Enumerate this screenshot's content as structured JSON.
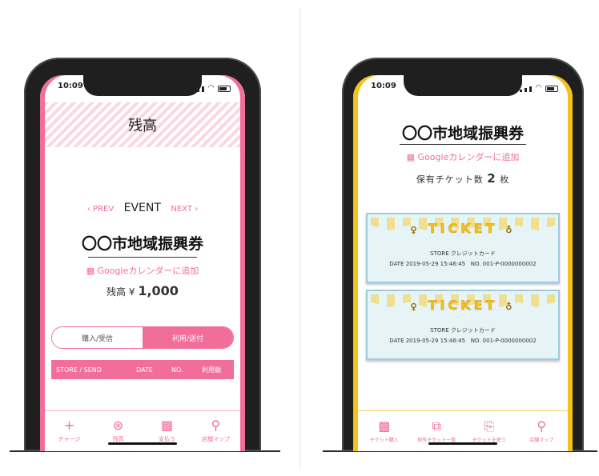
{
  "left_phone": {
    "status_time": "10:09",
    "header_title": "残高",
    "event_nav": {
      "prev": "‹ PREV",
      "label": "EVENT",
      "next": "NEXT ›"
    },
    "voucher_name": "〇〇市地域振興券",
    "calendar_link": "Googleカレンダーに追加",
    "balance_label": "残高 ¥",
    "balance_value": "1,000",
    "tabs": {
      "buy": "購入/受信",
      "use": "利用/送付"
    },
    "table_headers": [
      "STORE / SEND",
      "DATE",
      "NO.",
      "利用額"
    ],
    "nav": [
      {
        "icon": "plus-icon",
        "label": "チャージ"
      },
      {
        "icon": "yen-icon",
        "label": "残高"
      },
      {
        "icon": "qr-icon",
        "label": "支払う"
      },
      {
        "icon": "map-pin-icon",
        "label": "店舗マップ"
      }
    ],
    "accent_color": "#f06e98"
  },
  "right_phone": {
    "status_time": "10:09",
    "voucher_name": "〇〇市地域振興券",
    "calendar_link": "Googleカレンダーに追加",
    "ticket_count_label": "保有チケット数",
    "ticket_count": "2",
    "ticket_count_unit": "枚",
    "tickets": [
      {
        "title": "TICKET",
        "store": "STORE クレジットカード",
        "date": "DATE 2019-05-29 15:46:45",
        "no": "NO. 001-P-0000000002"
      },
      {
        "title": "TICKET",
        "store": "STORE クレジットカード",
        "date": "DATE 2019-05-29 15:46:45",
        "no": "NO. 001-P-0000000002"
      }
    ],
    "nav": [
      {
        "icon": "qr-icon",
        "label": "チケット購入"
      },
      {
        "icon": "ticket-list-icon",
        "label": "保有チケット一覧"
      },
      {
        "icon": "ticket-use-icon",
        "label": "チケットを使う"
      },
      {
        "icon": "map-pin-icon",
        "label": "店舗マップ"
      }
    ],
    "accent_color": "#f4c21b"
  }
}
